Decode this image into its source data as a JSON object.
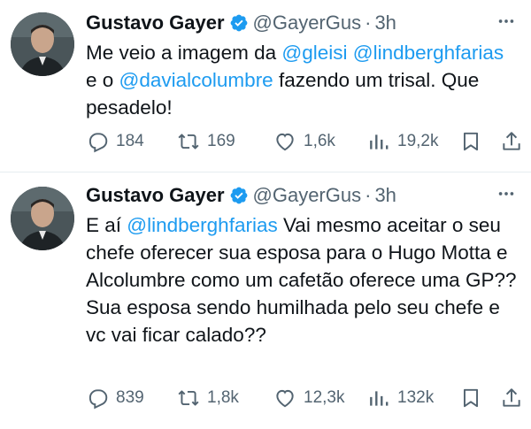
{
  "tweets": [
    {
      "author": {
        "name": "Gustavo Gayer",
        "handle": "@GayerGus",
        "time": "3h"
      },
      "text_segments": [
        {
          "t": "Me veio a imagem da ",
          "m": false
        },
        {
          "t": "@gleisi",
          "m": true
        },
        {
          "t": " ",
          "m": false
        },
        {
          "t": "@lindberghfarias",
          "m": true
        },
        {
          "t": " e o ",
          "m": false
        },
        {
          "t": "@davialcolumbre",
          "m": true
        },
        {
          "t": " fazendo um trisal. Que pesadelo!",
          "m": false
        }
      ],
      "stats": {
        "replies": "184",
        "retweets": "169",
        "likes": "1,6k",
        "views": "19,2k"
      }
    },
    {
      "author": {
        "name": "Gustavo Gayer",
        "handle": "@GayerGus",
        "time": "3h"
      },
      "text_segments": [
        {
          "t": "E aí ",
          "m": false
        },
        {
          "t": "@lindberghfarias",
          "m": true
        },
        {
          "t": " Vai mesmo aceitar o seu chefe oferecer sua esposa para o Hugo Motta e Alcolumbre como um cafetão oferece uma GP?? Sua esposa sendo humilhada pelo seu chefe e vc vai ficar calado??",
          "m": false
        }
      ],
      "stats": {
        "replies": "839",
        "retweets": "1,8k",
        "likes": "12,3k",
        "views": "132k"
      }
    }
  ],
  "colors": {
    "accent": "#1d9bf0",
    "muted": "#536471",
    "text": "#0f1419"
  },
  "icons": [
    "more-icon",
    "verified-badge-icon",
    "reply-icon",
    "retweet-icon",
    "like-icon",
    "views-icon",
    "bookmark-icon",
    "share-icon"
  ]
}
